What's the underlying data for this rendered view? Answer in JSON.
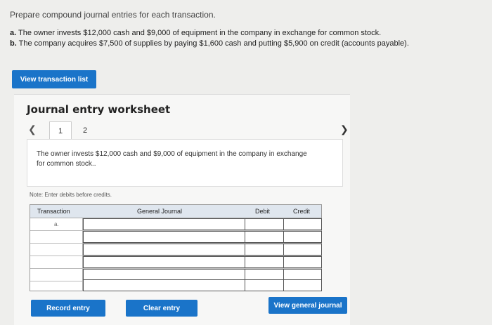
{
  "prompt": "Prepare compound journal entries for each transaction.",
  "transactions": [
    {
      "letter": "a.",
      "text": "The owner invests $12,000 cash and $9,000 of equipment in the company in exchange for common stock."
    },
    {
      "letter": "b.",
      "text": "The company acquires $7,500 of supplies by paying $1,600 cash and putting $5,900 on credit (accounts payable)."
    }
  ],
  "buttons": {
    "view_transaction_list": "View transaction list",
    "record_entry": "Record entry",
    "clear_entry": "Clear entry",
    "view_general_journal": "View general journal"
  },
  "worksheet": {
    "title": "Journal entry worksheet",
    "tabs": [
      "1",
      "2"
    ],
    "description": "The owner invests $12,000 cash and $9,000 of equipment in the company in exchange for common stock..",
    "note": "Note: Enter debits before credits."
  },
  "table": {
    "headers": {
      "transaction": "Transaction",
      "general_journal": "General Journal",
      "debit": "Debit",
      "credit": "Credit"
    },
    "rows": [
      {
        "transaction": "a."
      },
      {
        "transaction": ""
      },
      {
        "transaction": ""
      },
      {
        "transaction": ""
      },
      {
        "transaction": ""
      },
      {
        "transaction": ""
      }
    ]
  },
  "colors": {
    "accent": "#1a74c9",
    "header_bg": "#dfe6ee"
  }
}
